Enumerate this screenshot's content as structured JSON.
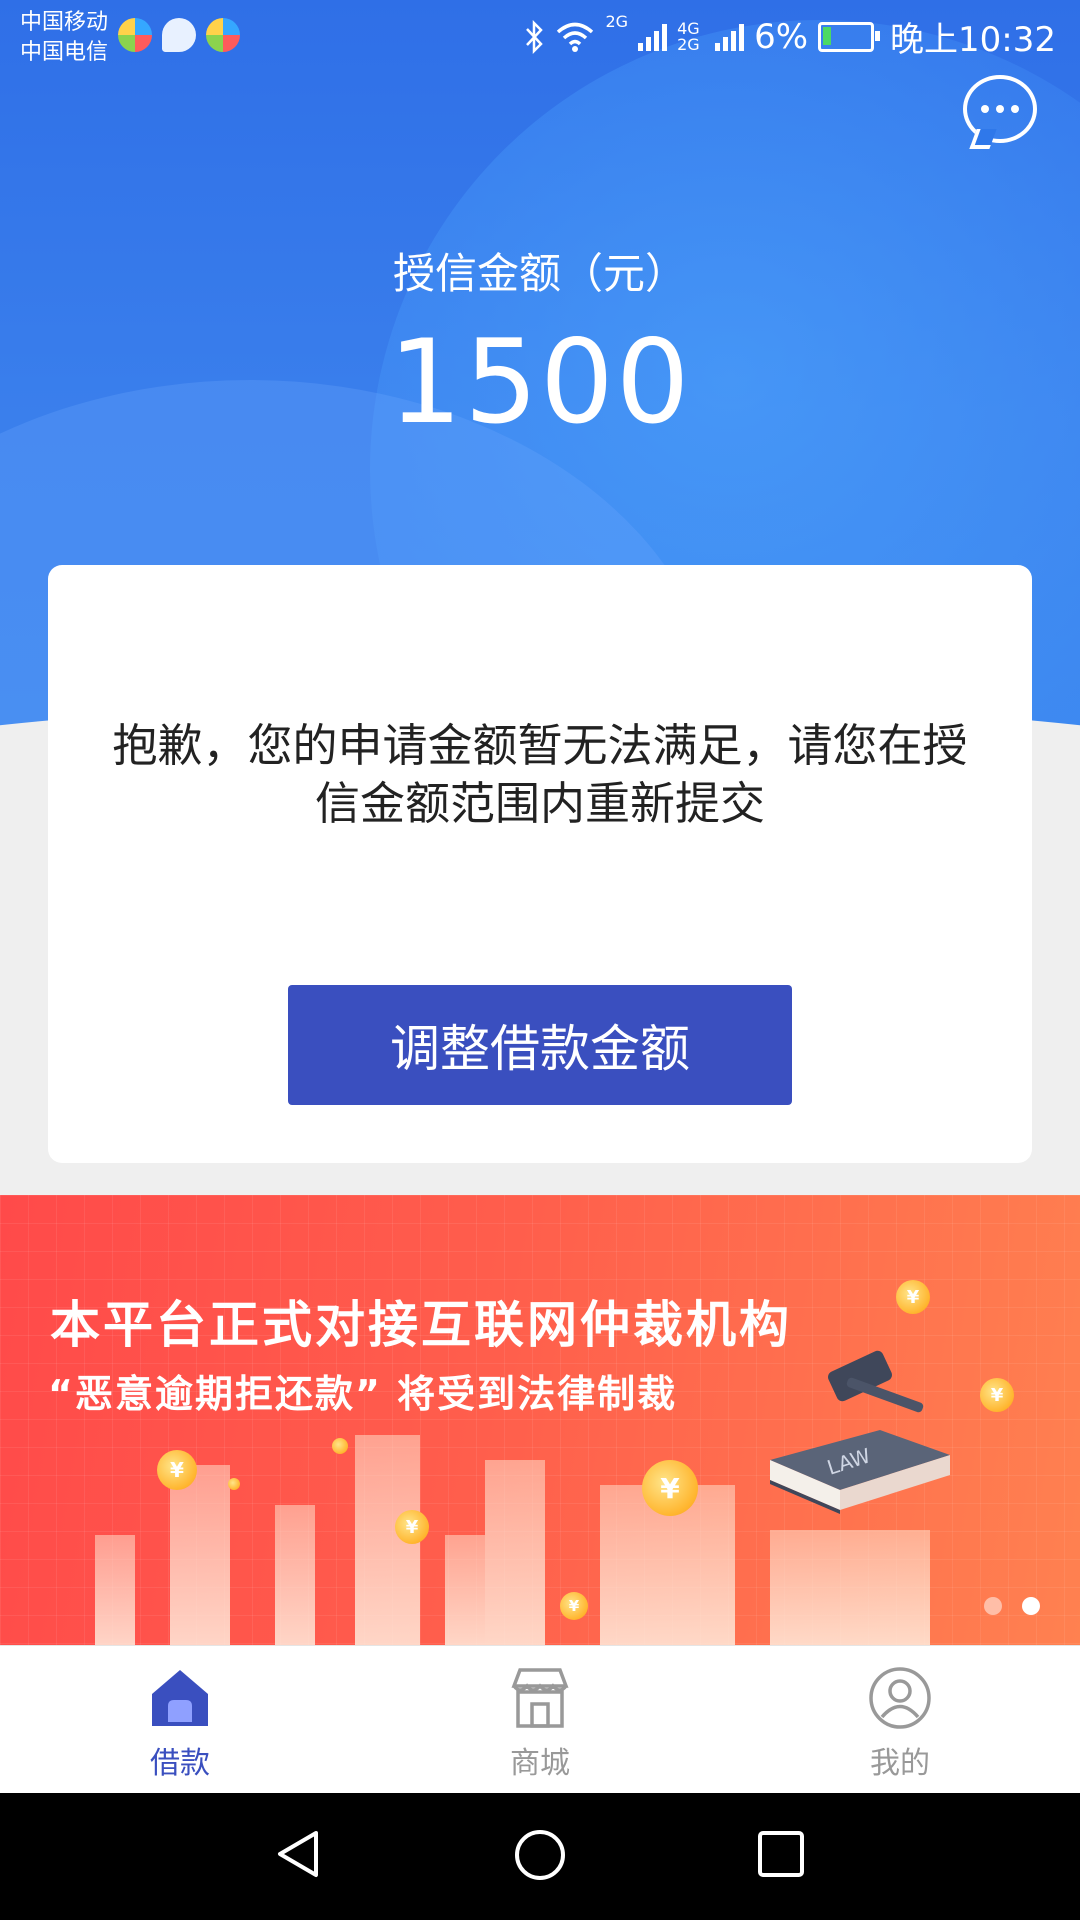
{
  "status_bar": {
    "carrier1": "中国移动",
    "carrier2": "中国电信",
    "network1": "2G",
    "network2": "4G 2G",
    "battery": "6%",
    "time": "晚上10:32"
  },
  "header": {
    "credit_label": "授信金额（元）",
    "credit_value": "1500"
  },
  "card": {
    "message": "抱歉，您的申请金额暂无法满足，请您在授信金额范围内重新提交",
    "button_label": "调整借款金额"
  },
  "banner": {
    "title": "本平台正式对接互联网仲裁机构",
    "subtitle": "“恶意逾期拒还款” 将受到法律制裁",
    "book_label": "LAW",
    "active_slide": 2,
    "slide_count": 2
  },
  "tabs": [
    {
      "label": "借款",
      "icon": "home-icon",
      "active": true
    },
    {
      "label": "商城",
      "icon": "shop-icon",
      "active": false
    },
    {
      "label": "我的",
      "icon": "user-icon",
      "active": false
    }
  ],
  "colors": {
    "primary": "#3a4fbf",
    "header_blue": "#2f6fe7",
    "tab_active": "#3a4fbf",
    "tab_inactive": "#999999"
  }
}
